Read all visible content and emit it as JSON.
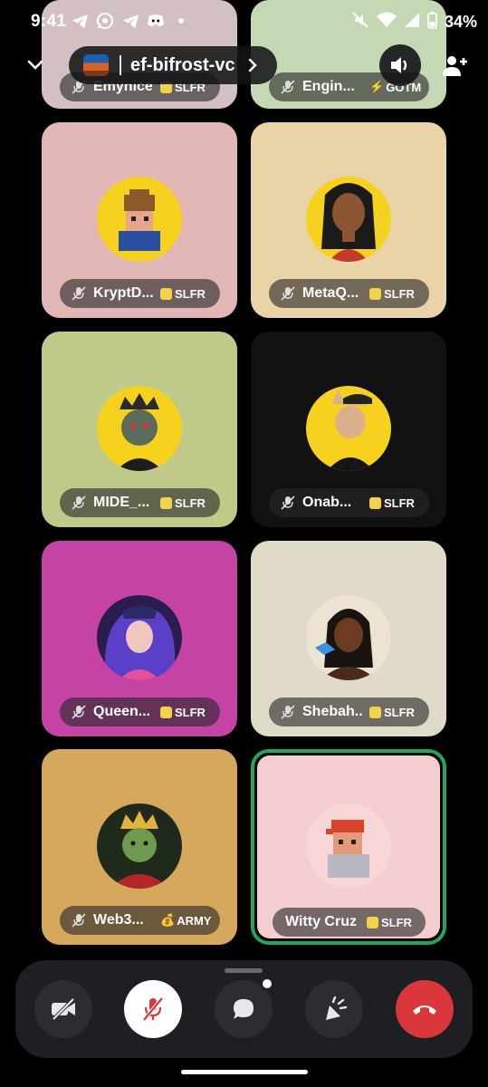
{
  "status_bar": {
    "time": "9:41",
    "battery": "34%",
    "icons": [
      "telegram-icon",
      "whatsapp-icon",
      "telegram-icon",
      "discord-icon",
      "dot-icon"
    ],
    "right_icons": [
      "mute-icon",
      "wifi-icon",
      "signal-icon",
      "battery-icon"
    ]
  },
  "header": {
    "channel_name": "ef-bifrost-vc",
    "collapse_icon": "chevron-down-icon",
    "chevron_icon": "chevron-right-icon",
    "speaker_icon": "speaker-icon",
    "invite_icon": "add-user-icon"
  },
  "participants": [
    {
      "name": "Emynice",
      "tag": "SLFR",
      "bg": "#d3c1c1"
    },
    {
      "name": "Engin...",
      "tag": "GOTM",
      "bg": "#c4d8b4"
    },
    {
      "name": "KryptD...",
      "tag": "SLFR",
      "bg": "#e2b6b5"
    },
    {
      "name": "MetaQ...",
      "tag": "SLFR",
      "bg": "#ebd3a8"
    },
    {
      "name": "MIDE_...",
      "tag": "SLFR",
      "bg": "#bfc98a"
    },
    {
      "name": "Onab...",
      "tag": "SLFR",
      "bg": "#111111"
    },
    {
      "name": "Queen...",
      "tag": "SLFR",
      "bg": "#c443a5"
    },
    {
      "name": "Shebah...",
      "tag": "SLFR",
      "bg": "#e0dac8"
    },
    {
      "name": "Web3...",
      "tag": "ARMY",
      "bg": "#d6a85c"
    },
    {
      "name": "Witty Cruz",
      "tag": "SLFR",
      "bg": "#f4cdd0",
      "speaking": true
    }
  ],
  "controls": {
    "camera": "camera-off-icon",
    "mic": "mic-muted-icon",
    "chat": "chat-icon",
    "activity": "activity-icon",
    "leave": "hang-up-icon"
  },
  "colors": {
    "speaking_ring": "#23a55a",
    "leave_red": "#da373c",
    "control_bar": "#1e1f22"
  }
}
